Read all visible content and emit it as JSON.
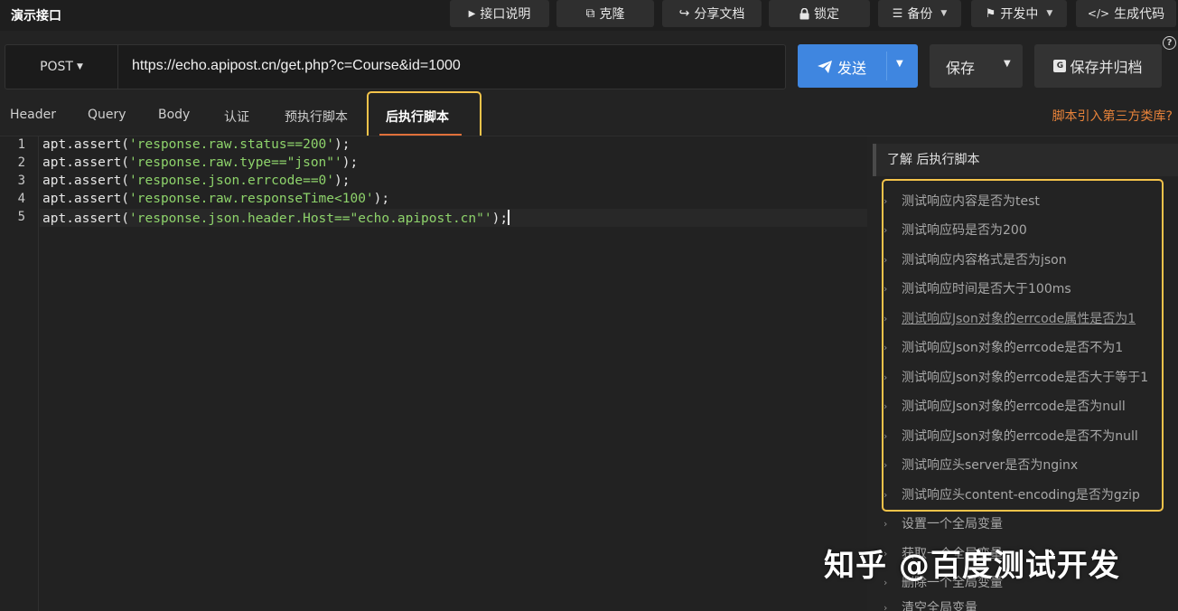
{
  "app": {
    "title": "演示接口"
  },
  "toolbar": {
    "doc_label": "接口说明",
    "clone_label": "克隆",
    "share_label": "分享文档",
    "lock_label": "锁定",
    "backup_label": "备份",
    "status_label": "开发中",
    "codegen_label": "生成代码"
  },
  "request": {
    "method": "POST",
    "url": "https://echo.apipost.cn/get.php?c=Course&id=1000",
    "send_label": "发送",
    "save_label": "保存",
    "save_archive_label": "保存并归档"
  },
  "tabs": [
    {
      "label": "Header"
    },
    {
      "label": "Query"
    },
    {
      "label": "Body"
    },
    {
      "label": "认证"
    },
    {
      "label": "预执行脚本"
    },
    {
      "label": "后执行脚本"
    }
  ],
  "active_tab": "后执行脚本",
  "lib_link": "脚本引入第三方类库?",
  "editor": {
    "line_numbers": [
      "1",
      "2",
      "3",
      "4",
      "5"
    ],
    "lines": [
      {
        "pre": "apt.assert(",
        "str": "'response.raw.status==200'",
        "post": ");"
      },
      {
        "pre": "apt.assert(",
        "str": "'response.raw.type==\"json\"'",
        "post": ");"
      },
      {
        "pre": "apt.assert(",
        "str": "'response.json.errcode==0'",
        "post": ");"
      },
      {
        "pre": "apt.assert(",
        "str": "'response.raw.responseTime<100'",
        "post": ");"
      },
      {
        "pre": "apt.assert(",
        "str": "'response.json.header.Host==\"echo.apipost.cn\"'",
        "post": ");"
      }
    ]
  },
  "side_panel": {
    "heading": "了解 后执行脚本",
    "snippets": [
      "测试响应内容是否为test",
      "测试响应码是否为200",
      "测试响应内容格式是否为json",
      "测试响应时间是否大于100ms",
      "测试响应Json对象的errcode属性是否为1",
      "测试响应Json对象的errcode是否不为1",
      "测试响应Json对象的errcode是否大于等于1",
      "测试响应Json对象的errcode是否为null",
      "测试响应Json对象的errcode是否不为null",
      "测试响应头server是否为nginx",
      "测试响应头content-encoding是否为gzip",
      "设置一个全局变量",
      "获取一个全局变量",
      "删除一个全局变量",
      "清空全局变量"
    ]
  },
  "watermark": "知乎 @百度测试开发",
  "colors": {
    "accent_blue": "#3f86e0",
    "highlight_yellow": "#f4c34a",
    "link_orange": "#e8833a",
    "string_green": "#8ed36b"
  }
}
